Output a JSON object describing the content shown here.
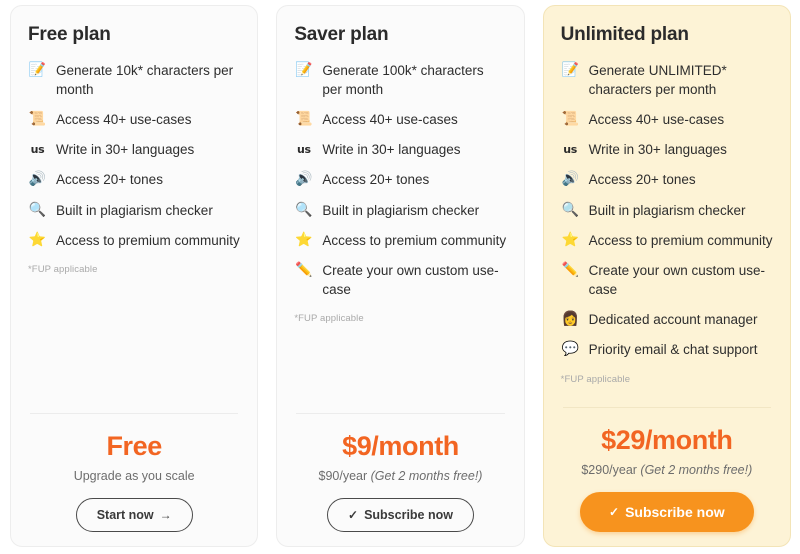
{
  "theme": {
    "accent_orange": "#f26522",
    "cta_orange": "#f7931e",
    "highlight_bg": "#fdf3d6",
    "neutral_bg": "#fbfbfb"
  },
  "plans": [
    {
      "id": "free",
      "title": "Free plan",
      "highlighted": false,
      "features": [
        {
          "icon": "memo-icon",
          "glyph": "📝",
          "text": "Generate 10k* characters per month"
        },
        {
          "icon": "scroll-icon",
          "glyph": "📜",
          "text": "Access 40+ use-cases"
        },
        {
          "icon": "abc-icon",
          "glyph": "us",
          "text": "Write in 30+ languages"
        },
        {
          "icon": "speaker-icon",
          "glyph": "🔊",
          "text": "Access 20+ tones"
        },
        {
          "icon": "magnifier-icon",
          "glyph": "🔍",
          "text": "Built in plagiarism checker"
        },
        {
          "icon": "star-icon",
          "glyph": "⭐",
          "text": "Access to premium community"
        }
      ],
      "footnote": "*FUP applicable",
      "price_main": "Free",
      "price_sub_primary": "Upgrade as you scale",
      "price_sub_promo": "",
      "cta_label": "Start now",
      "cta_glyph": "→",
      "cta_glyph_position": "after",
      "cta_style": "outline"
    },
    {
      "id": "saver",
      "title": "Saver plan",
      "highlighted": false,
      "features": [
        {
          "icon": "memo-icon",
          "glyph": "📝",
          "text": "Generate 100k* characters per month"
        },
        {
          "icon": "scroll-icon",
          "glyph": "📜",
          "text": "Access 40+ use-cases"
        },
        {
          "icon": "abc-icon",
          "glyph": "us",
          "text": "Write in 30+ languages"
        },
        {
          "icon": "speaker-icon",
          "glyph": "🔊",
          "text": "Access 20+ tones"
        },
        {
          "icon": "magnifier-icon",
          "glyph": "🔍",
          "text": "Built in plagiarism checker"
        },
        {
          "icon": "star-icon",
          "glyph": "⭐",
          "text": "Access to premium community"
        },
        {
          "icon": "pencil-icon",
          "glyph": "✏️",
          "text": "Create your own custom use-case"
        }
      ],
      "footnote": "*FUP applicable",
      "price_main": "$9/month",
      "price_sub_primary": "$90/year ",
      "price_sub_promo": "(Get 2 months free!)",
      "cta_label": "Subscribe now",
      "cta_glyph": "✓",
      "cta_glyph_position": "before",
      "cta_style": "outline"
    },
    {
      "id": "unlimited",
      "title": "Unlimited plan",
      "highlighted": true,
      "features": [
        {
          "icon": "memo-icon",
          "glyph": "📝",
          "text": "Generate UNLIMITED* characters per month"
        },
        {
          "icon": "scroll-icon",
          "glyph": "📜",
          "text": "Access 40+ use-cases"
        },
        {
          "icon": "abc-icon",
          "glyph": "us",
          "text": "Write in 30+ languages"
        },
        {
          "icon": "speaker-icon",
          "glyph": "🔊",
          "text": "Access 20+ tones"
        },
        {
          "icon": "magnifier-icon",
          "glyph": "🔍",
          "text": "Built in plagiarism checker"
        },
        {
          "icon": "star-icon",
          "glyph": "⭐",
          "text": "Access to premium community"
        },
        {
          "icon": "pencil-icon",
          "glyph": "✏️",
          "text": "Create your own custom use-case"
        },
        {
          "icon": "account-manager-icon",
          "glyph": "👩",
          "text": "Dedicated account manager"
        },
        {
          "icon": "chat-support-icon",
          "glyph": "💬",
          "text": "Priority email & chat support"
        }
      ],
      "footnote": "*FUP applicable",
      "price_main": "$29/month",
      "price_sub_primary": "$290/year ",
      "price_sub_promo": "(Get 2 months free!)",
      "cta_label": "Subscribe now",
      "cta_glyph": "✓",
      "cta_glyph_position": "before",
      "cta_style": "filled"
    }
  ]
}
